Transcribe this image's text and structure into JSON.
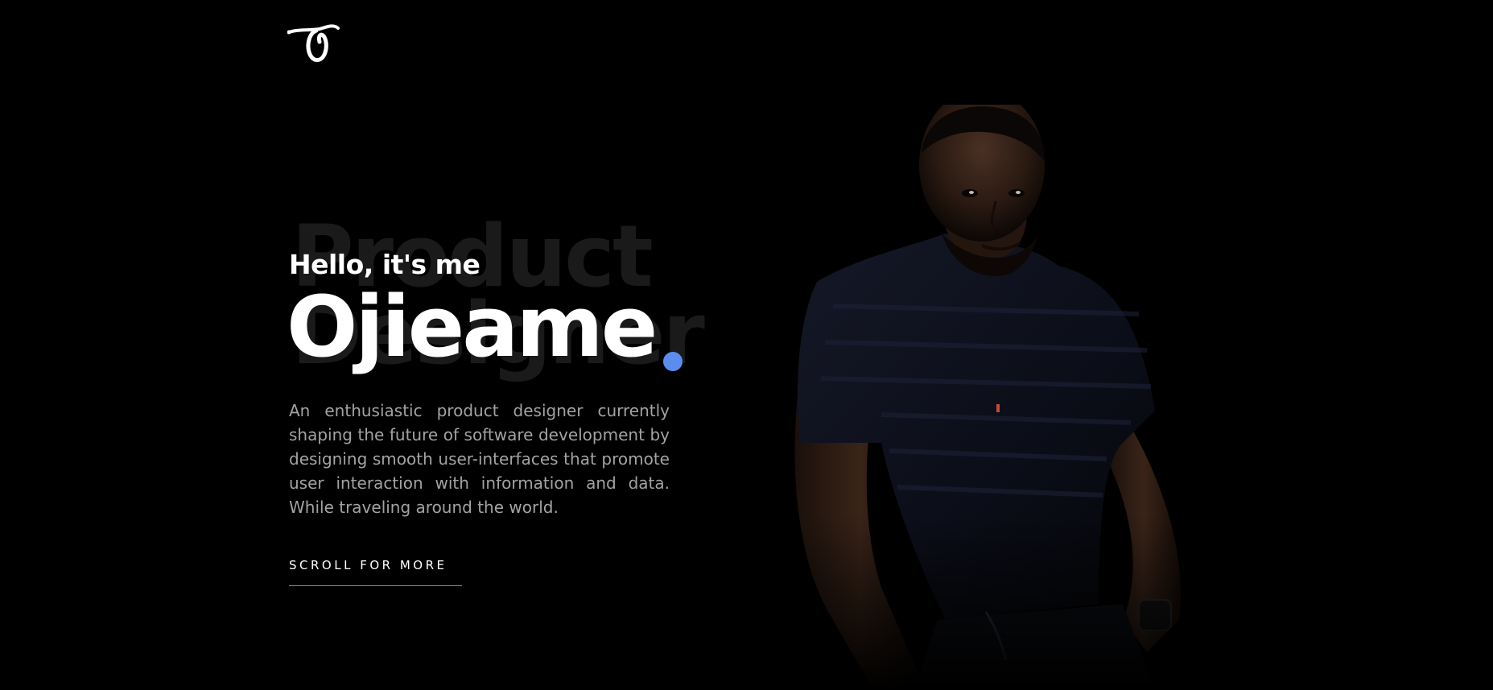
{
  "header": {
    "logo_alt": "Ojieame logo"
  },
  "hero": {
    "background_words": [
      "Product",
      "Designer"
    ],
    "greeting": "Hello, it's me",
    "name": "Ojieame",
    "bio": "An enthusiastic product designer currently shaping the future of software development by designing smooth user-interfaces that promote user interaction with information and data. While traveling around the world.",
    "cta_label": "SCROLL FOR MORE"
  },
  "colors": {
    "background": "#000000",
    "text_primary": "#ffffff",
    "text_secondary": "#a3a3a3",
    "accent": "#5b8def",
    "background_word": "#1a1a1a"
  },
  "icons": {
    "logo": "script-o-logo-icon",
    "portrait": "portrait-photo"
  }
}
